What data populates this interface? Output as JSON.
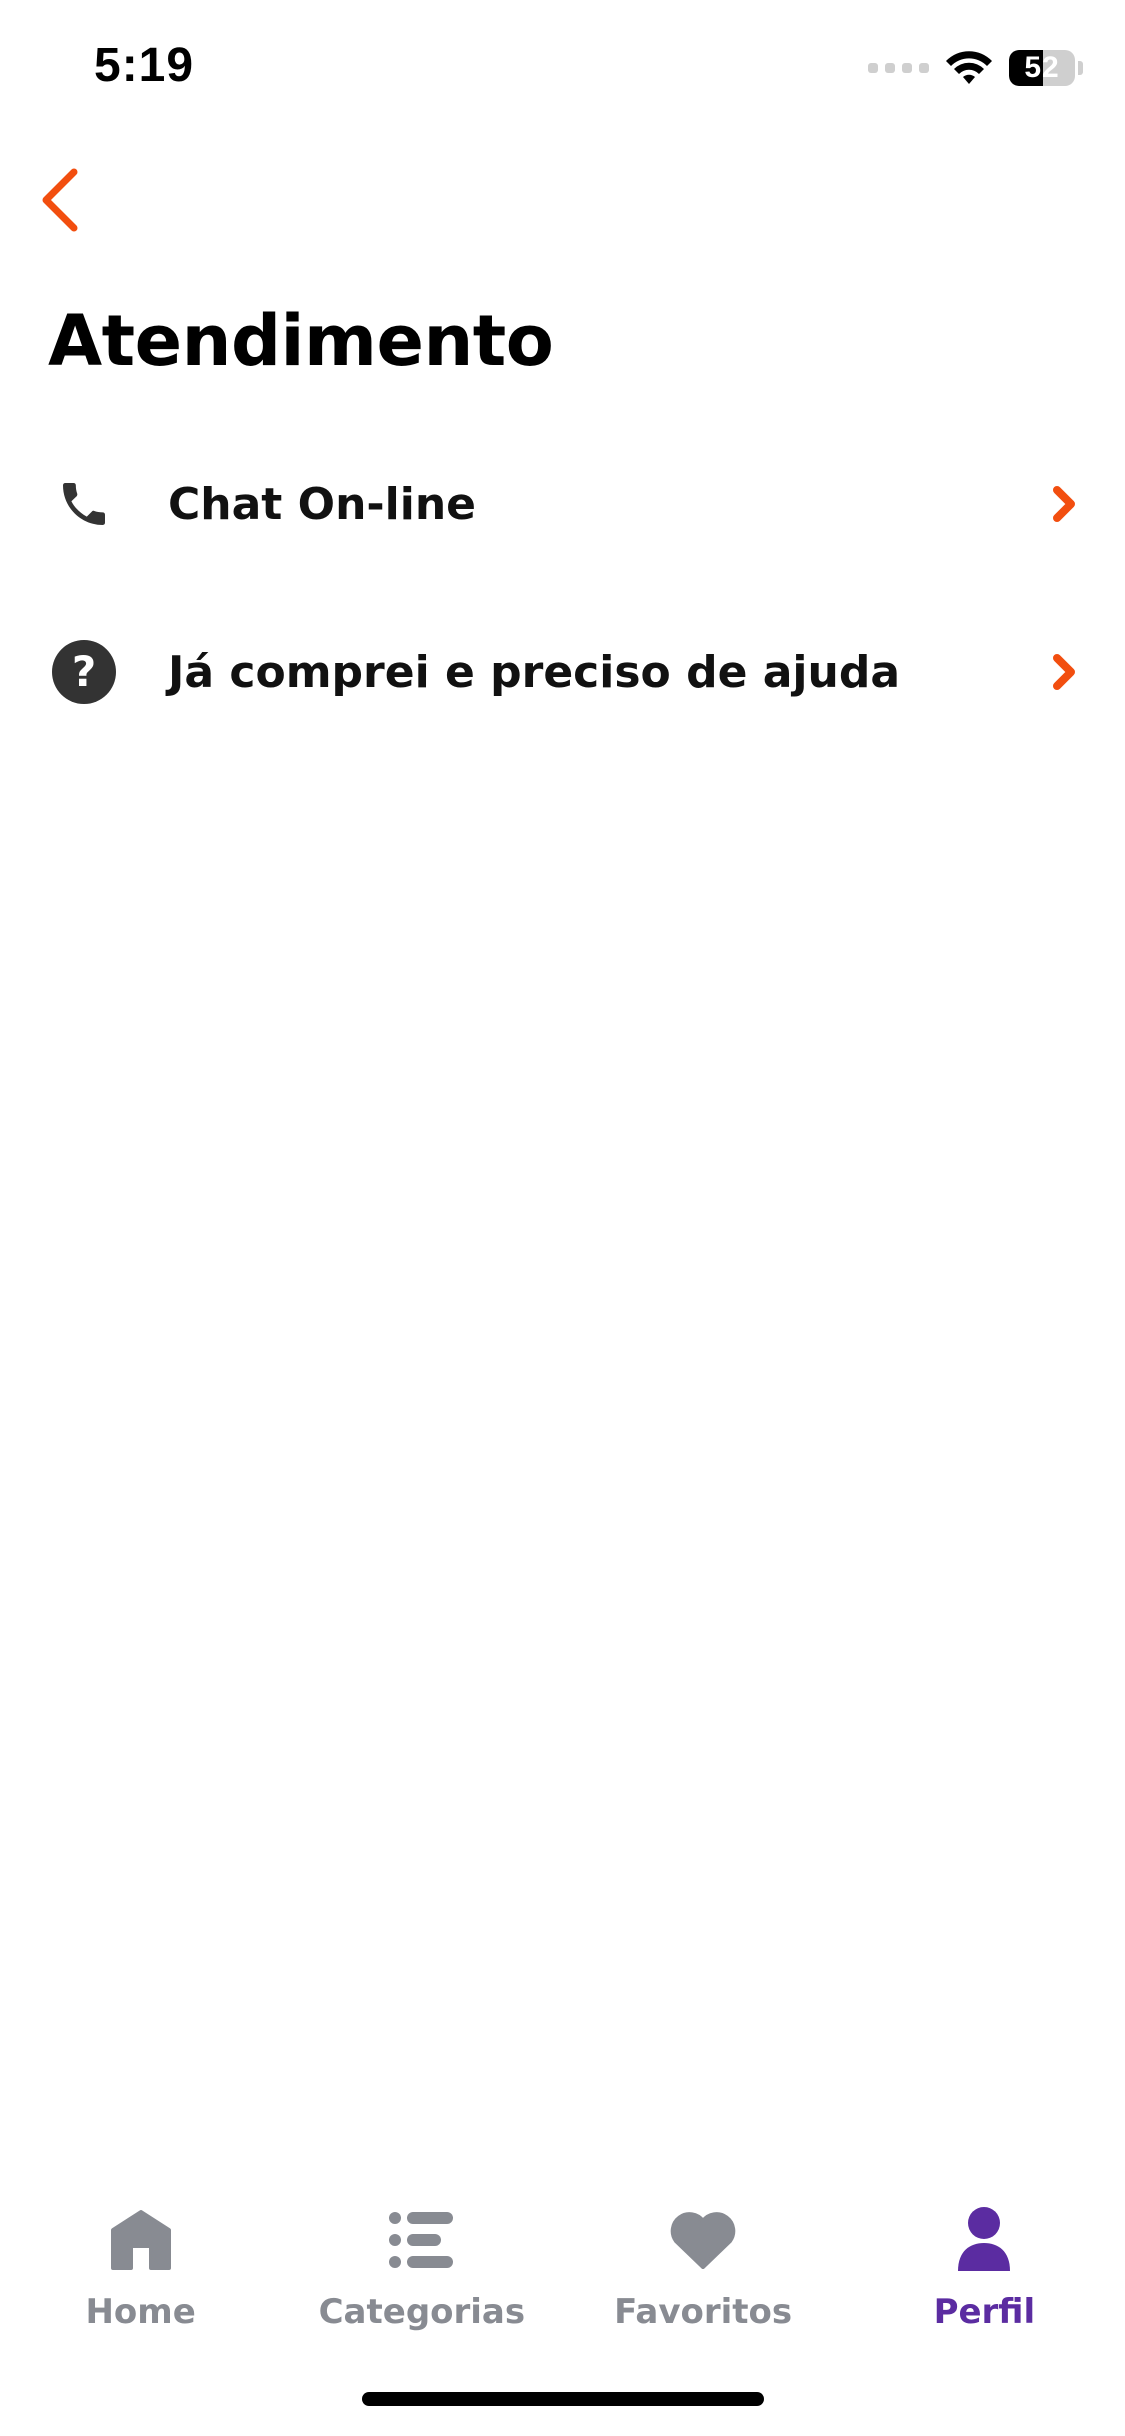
{
  "status_bar": {
    "time": "5:19",
    "battery_level": "52",
    "battery_fraction": 0.52
  },
  "header": {
    "back_icon": "chevron-left-icon",
    "title": "Atendimento"
  },
  "menu": {
    "items": [
      {
        "label": "Chat On-line",
        "icon": "phone-icon"
      },
      {
        "label": "Já comprei e preciso de ajuda",
        "icon": "question-circle-icon"
      }
    ]
  },
  "tab_bar": {
    "active_index": 3,
    "items": [
      {
        "label": "Home",
        "icon": "home-icon"
      },
      {
        "label": "Categorias",
        "icon": "list-icon"
      },
      {
        "label": "Favoritos",
        "icon": "heart-icon"
      },
      {
        "label": "Perfil",
        "icon": "user-icon"
      }
    ]
  },
  "colors": {
    "accent": "#F24E0F",
    "active_tab": "#5B2CA1",
    "inactive_tab": "#888B92",
    "icon_dark": "#333333"
  }
}
